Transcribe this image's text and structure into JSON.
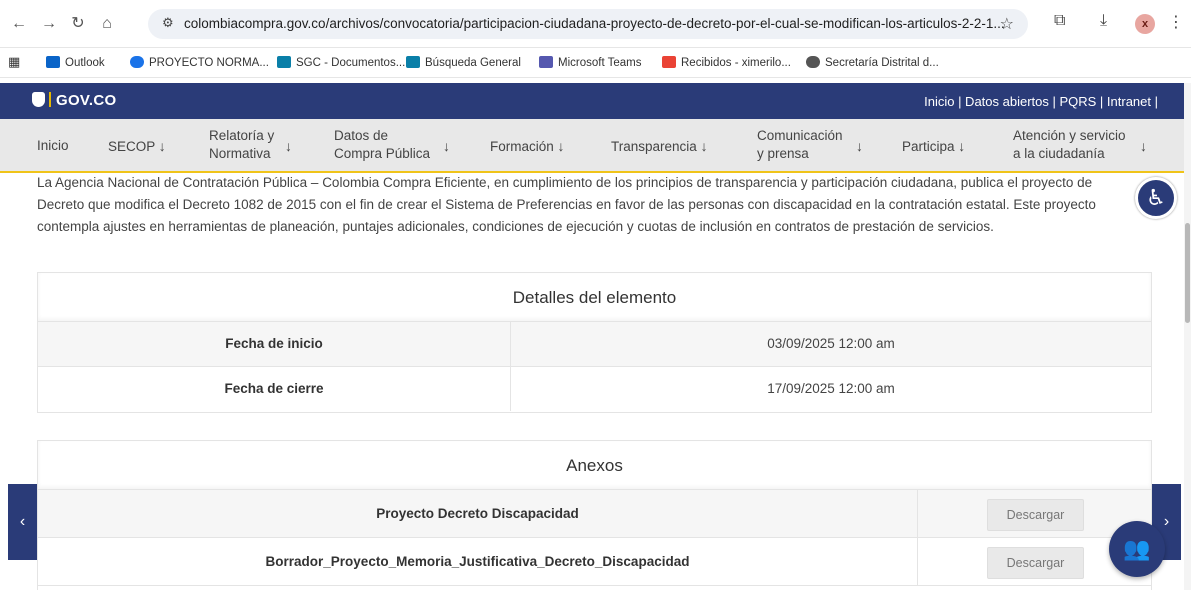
{
  "browser": {
    "url": "colombiacompra.gov.co/archivos/convocatoria/participacion-ciudadana-proyecto-de-decreto-por-el-cual-se-modifican-los-articulos-2-2-1...",
    "profile_initial": "x",
    "bookmarks": [
      "Outlook",
      "PROYECTO NORMA...",
      "SGC - Documentos...",
      "Búsqueda General",
      "Microsoft Teams",
      "Recibidos - ximerilo...",
      "Secretaría Distrital d..."
    ]
  },
  "gov_header": {
    "logo": "GOV.CO",
    "links": "Inicio | Datos abiertos | PQRS | Intranet |"
  },
  "nav": {
    "inicio": "Inicio",
    "secop": "SECOP",
    "relatoria_1": "Relatoría y",
    "relatoria_2": "Normativa",
    "datos_1": "Datos de",
    "datos_2": "Compra Pública",
    "formacion": "Formación",
    "transparencia": "Transparencia",
    "comunicacion_1": "Comunicación",
    "comunicacion_2": "y prensa",
    "participa": "Participa",
    "atencion_1": "Atención y servicio",
    "atencion_2": "a la ciudadanía",
    "arrow": "↓"
  },
  "intro": "La Agencia Nacional de Contratación Pública – Colombia Compra Eficiente, en cumplimiento de los principios de transparencia y participación ciudadana, publica el proyecto de Decreto que modifica el Decreto 1082 de 2015 con el fin de crear el Sistema de Preferencias en favor de las personas con discapacidad en la contratación estatal. Este proyecto contempla ajustes en herramientas de planeación, puntajes adicionales, condiciones de ejecución y cuotas de inclusión en contratos de prestación de servicios.",
  "details": {
    "title": "Detalles del elemento",
    "rows": [
      {
        "label": "Fecha de inicio",
        "value": "03/09/2025 12:00 am"
      },
      {
        "label": "Fecha de cierre",
        "value": "17/09/2025 12:00 am"
      }
    ]
  },
  "annexes": {
    "title": "Anexos",
    "items": [
      {
        "name": "Proyecto Decreto Discapacidad",
        "button": "Descargar"
      },
      {
        "name": "Borrador_Proyecto_Memoria_Justificativa_Decreto_Discapacidad",
        "button": "Descargar"
      }
    ]
  },
  "colors": {
    "gov_blue": "#2a3b78",
    "accent_yellow": "#f0c419",
    "nav_bg": "#e8e8e8"
  }
}
